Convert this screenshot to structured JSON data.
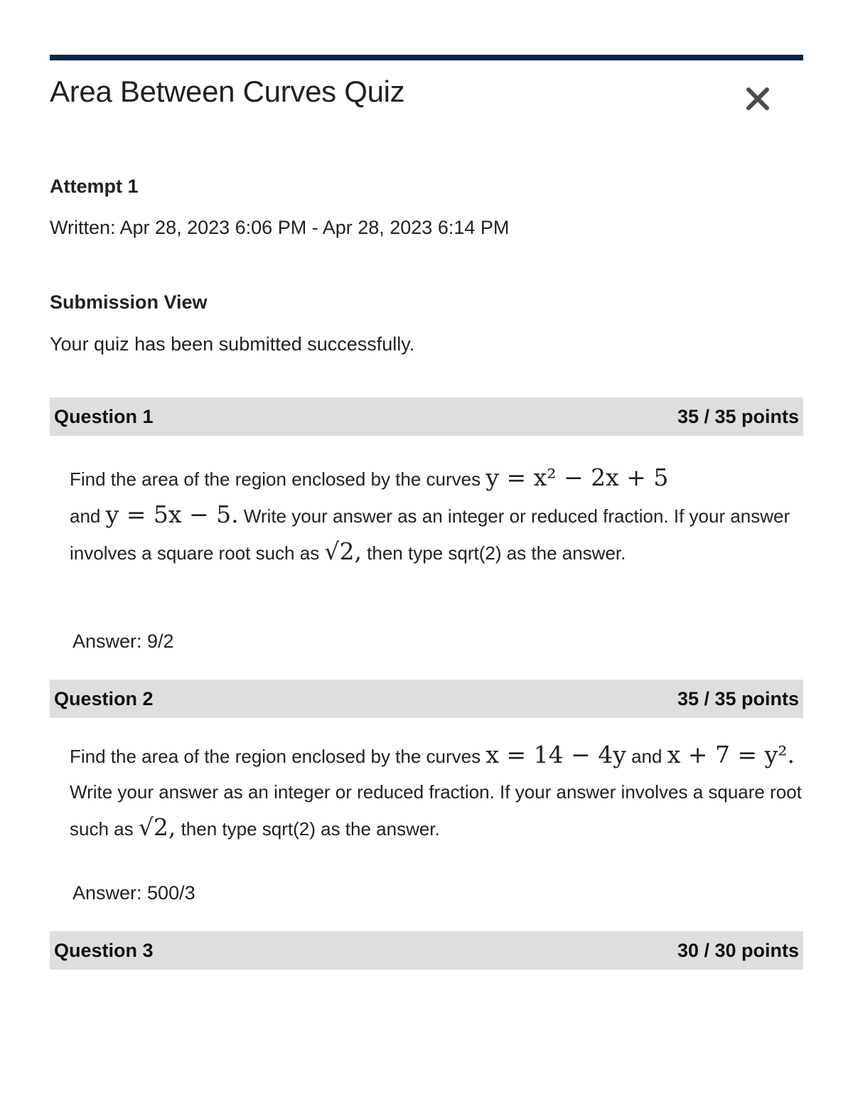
{
  "header": {
    "title": "Area Between Curves Quiz",
    "close_icon": "close-x-icon"
  },
  "attempt": {
    "label": "Attempt 1",
    "written": "Written: Apr 28, 2023 6:06 PM - Apr 28, 2023 6:14 PM"
  },
  "submission": {
    "label": "Submission View",
    "message": "Your quiz has been submitted successfully."
  },
  "colors": {
    "top_bar": "#0a2448",
    "question_header_bg": "#dedede",
    "close_icon": "#494c4e",
    "text": "#202122"
  },
  "questions": [
    {
      "label": "Question 1",
      "score": "35 / 35 points",
      "text": {
        "intro": "Find the area of the region enclosed by the curves ",
        "eq1": "y = x² − 2x + 5",
        "joiner": " and ",
        "eq2": "y = 5x − 5.",
        "instructions_1": " Write your answer as an integer or reduced fraction.  If your answer involves a square root such as ",
        "sqrt_example": "√2,",
        "instructions_2": " then type sqrt(2) as the answer."
      },
      "answer": "Answer: 9/2"
    },
    {
      "label": "Question 2",
      "score": "35 / 35 points",
      "text": {
        "intro": "Find the area of the region enclosed by the curves ",
        "eq1": "x = 14 − 4y",
        "joiner": " and ",
        "eq2": "x + 7 = y².",
        "instructions_1": " Write your answer as an integer or reduced fraction.  If your answer involves a square root such as ",
        "sqrt_example": "√2,",
        "instructions_2": " then type sqrt(2) as the answer."
      },
      "answer": "Answer: 500/3"
    },
    {
      "label": "Question 3",
      "score": "30 / 30 points"
    }
  ]
}
